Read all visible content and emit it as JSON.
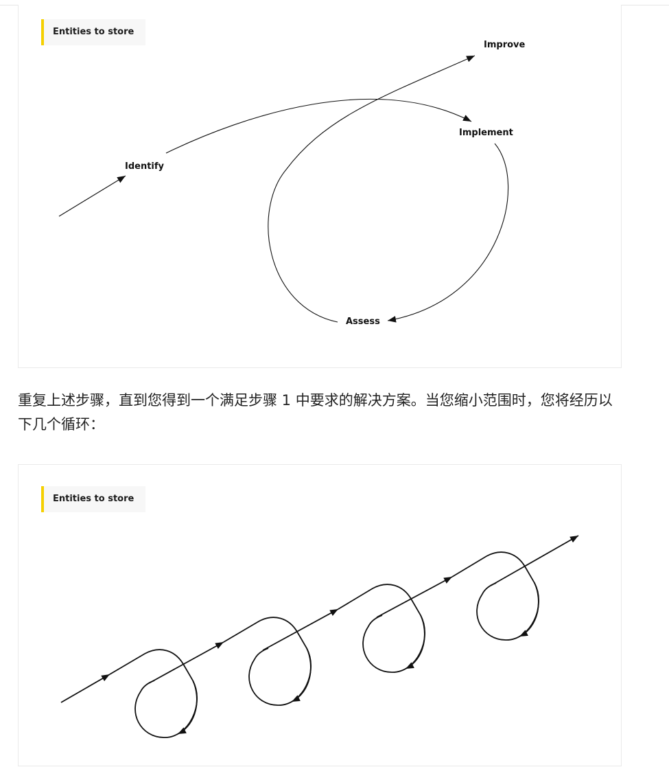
{
  "diagram_1": {
    "tag": "Entities to store",
    "labels": {
      "improve": "Improve",
      "implement": "Implement",
      "identify": "Identify",
      "assess": "Assess"
    }
  },
  "paragraph": "重复上述步骤，直到您得到一个满足步骤 1 中要求的解决方案。当您缩小范围时，您将经历以下几个循环：",
  "diagram_2": {
    "tag": "Entities to store",
    "loop_count": 4
  }
}
